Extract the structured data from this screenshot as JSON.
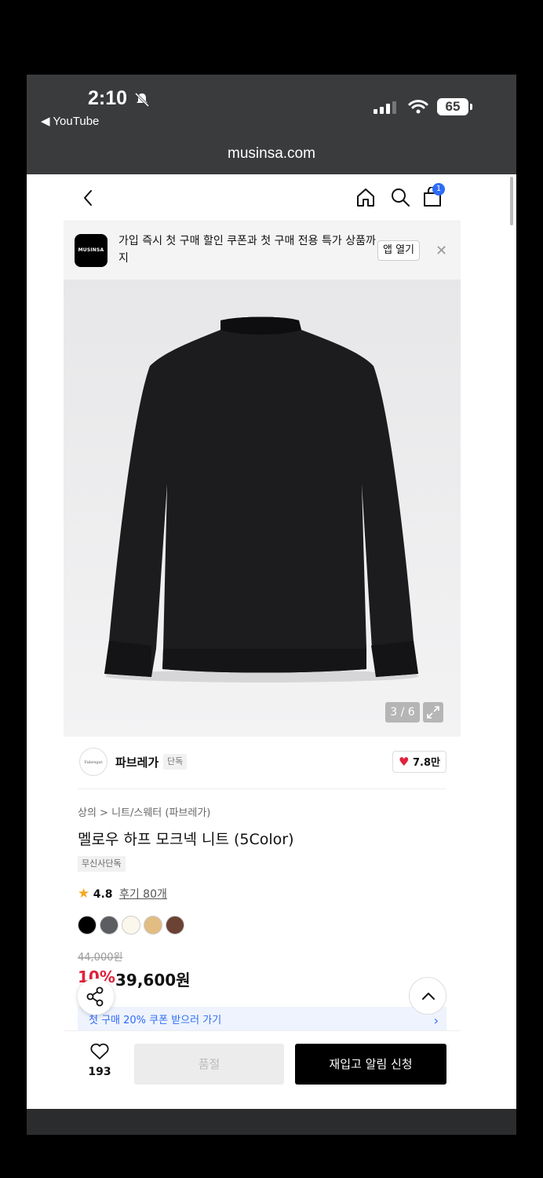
{
  "status": {
    "time": "2:10",
    "back_app": "◀ YouTube",
    "battery": "65"
  },
  "browser": {
    "url": "musinsa.com"
  },
  "nav": {
    "cart_count": "1"
  },
  "banner": {
    "logo_text": "MUSINSA",
    "text": "가입 즉시 첫 구매 할인 쿠폰과 첫 구매 전용 특가 상품까지",
    "open_app_label": "앱 열기",
    "close": "✕"
  },
  "gallery": {
    "counter": "3 / 6"
  },
  "brand": {
    "logo_text": "Fabregat",
    "name": "파브레가",
    "badge": "단독",
    "likes": "7.8만",
    "heart": "♥"
  },
  "product": {
    "breadcrumb": "상의 > 니트/스웨터 (파브레가)",
    "title": "멜로우 하프 모크넥 니트 (5Color)",
    "badge": "무신사단독",
    "star": "★",
    "rating": "4.8",
    "reviews": "후기 80개",
    "colors": [
      "#000000",
      "#5b5d60",
      "#fbf7ec",
      "#e1bd83",
      "#6b4233"
    ],
    "original_price": "44,000원",
    "discount": "10%",
    "price": "39,600원"
  },
  "coupon": {
    "text": "첫 구매 20% 쿠폰 받으러 가기",
    "chevron": "›"
  },
  "bottom": {
    "wish_count": "193",
    "soldout_label": "품절",
    "restock_label": "재입고 알림 신청"
  }
}
